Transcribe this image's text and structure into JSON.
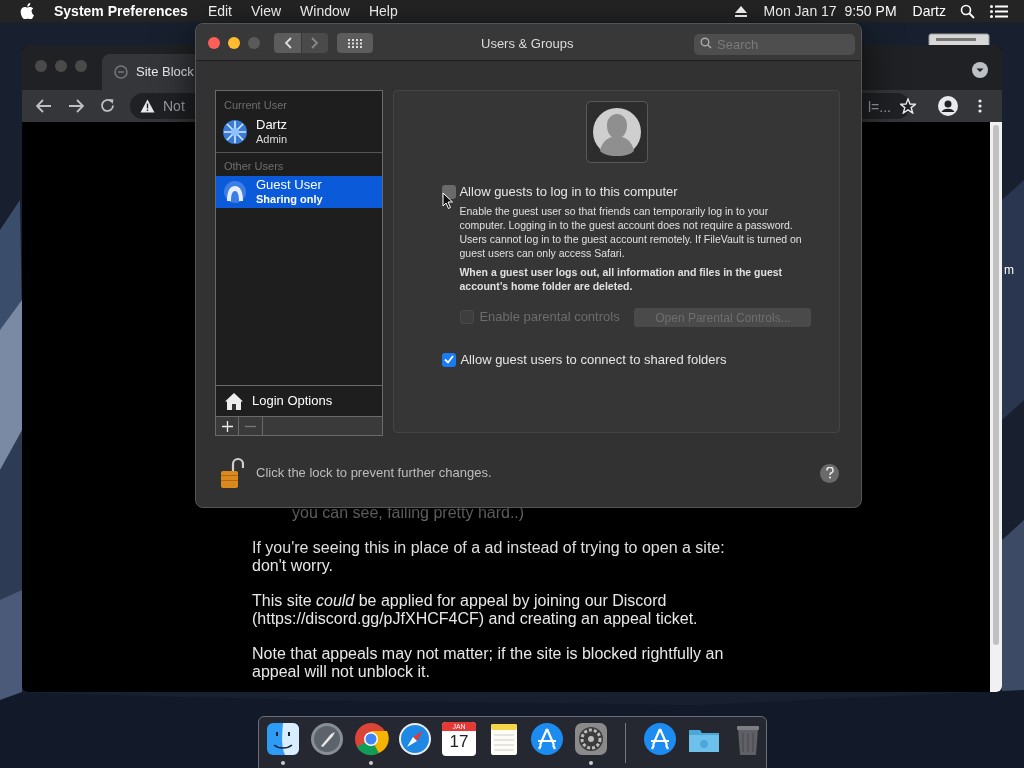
{
  "menu_bar": {
    "app_name": "System Preferences",
    "items": [
      "Edit",
      "View",
      "Window",
      "Help"
    ],
    "clock": "Mon Jan 17  9:50 PM",
    "user": "Dartz"
  },
  "browser": {
    "tab_title": "Site Block",
    "url_start": "Not",
    "url_end": "l=...",
    "content": {
      "fragment": "you can see, failing pretty hard..)",
      "paragraphs": [
        "If you're seeing this in place of a ad instead of trying to open a site: don't worry.",
        "This site *could* be applied for appeal by joining our Discord (https://discord.gg/pJfXHCF4CF) and creating an appeal ticket.",
        "Note that appeals may not matter; if the site is blocked rightfully an appeal will not unblock it."
      ]
    }
  },
  "desktop_fragment": "m",
  "window": {
    "title": "Users & Groups",
    "search_placeholder": "Search",
    "sidebar": {
      "sections": [
        {
          "heading": "Current User",
          "users": [
            {
              "name": "Dartz",
              "role": "Admin",
              "kind": "admin",
              "selected": false
            }
          ]
        },
        {
          "heading": "Other Users",
          "users": [
            {
              "name": "Guest User",
              "role": "Sharing only",
              "kind": "guest",
              "selected": true
            }
          ]
        }
      ],
      "login_options": "Login Options"
    },
    "panel": {
      "allow_login": {
        "label": "Allow guests to log in to this computer",
        "checked": false
      },
      "description": "Enable the guest user so that friends can temporarily log in to your computer. Logging in to the guest account does not require a password. Users cannot log in to the guest account remotely. If FileVault is turned on guest users can only access Safari.",
      "warning": "When a guest user logs out, all information and files in the guest account’s home folder are deleted.",
      "parental": {
        "label": "Enable parental controls",
        "checked": false,
        "disabled": true
      },
      "parental_button": {
        "label": "Open Parental Controls...",
        "disabled": true
      },
      "shared_folders": {
        "label": "Allow guest users to connect to shared folders",
        "checked": true
      }
    },
    "lock_text": "Click the lock to prevent further changes."
  },
  "dock": [
    {
      "kind": "finder",
      "running": true
    },
    {
      "kind": "launchpad",
      "running": false
    },
    {
      "kind": "chrome",
      "running": true
    },
    {
      "kind": "safari",
      "running": false
    },
    {
      "kind": "calendar",
      "running": false,
      "month": "JAN",
      "day": "17"
    },
    {
      "kind": "notes",
      "running": false
    },
    {
      "kind": "appstore",
      "running": false
    },
    {
      "kind": "settings",
      "running": true
    },
    {
      "kind": "divider"
    },
    {
      "kind": "appstore",
      "running": false
    },
    {
      "kind": "folder",
      "running": false
    },
    {
      "kind": "trash",
      "running": false
    }
  ]
}
